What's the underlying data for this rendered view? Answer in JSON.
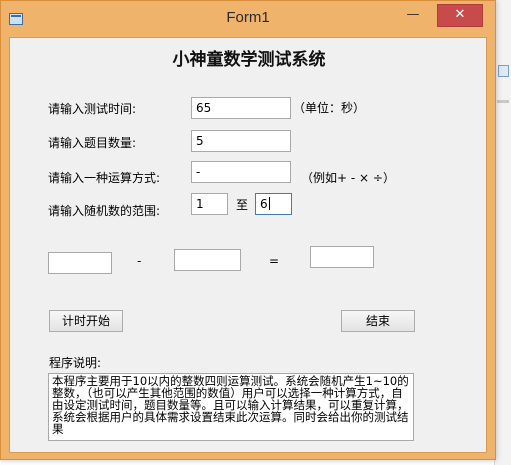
{
  "window": {
    "title": "Form1",
    "minimize_glyph": "—",
    "maximize_glyph": "☐",
    "close_glyph": "✕"
  },
  "form": {
    "heading": "小神童数学测试系统",
    "time_label": "请输入测试时间:",
    "time_value": "65",
    "time_unit": "（单位：秒）",
    "count_label": "请输入题目数量:",
    "count_value": "5",
    "op_label": "请输入一种运算方式:",
    "op_value": "-",
    "op_hint": "（例如+  -  ×  ÷）",
    "range_label": "请输入随机数的范围:",
    "range_min": "1",
    "range_to": "至",
    "range_max": "6"
  },
  "question": {
    "operand1": "",
    "operator": "-",
    "operand2": "",
    "equals": "=",
    "answer": ""
  },
  "buttons": {
    "start": "计时开始",
    "end": "结束"
  },
  "description": {
    "label": "程序说明:",
    "text": "本程序主要用于10以内的整数四则运算测试。系统会随机产生1~10的整数，（也可以产生其他范围的数值）用户可以选择一种计算方式，自由设定测试时间，题目数量等。且可以输入计算结果，可以重复计算，系统会根据用户的具体需求设置结束此次运算。同时会给出你的测试结果"
  }
}
